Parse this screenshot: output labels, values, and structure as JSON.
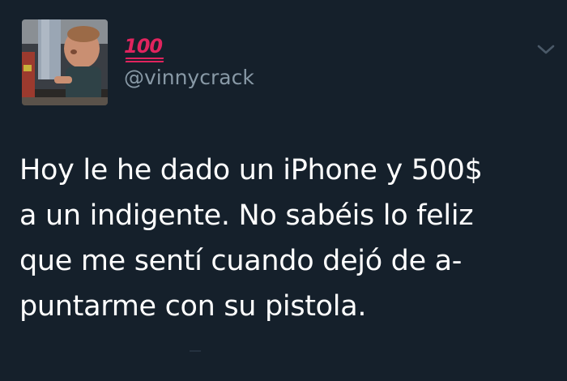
{
  "tweet": {
    "display_name_emoji": "💯",
    "display_name_glyph": "100",
    "handle": "@vinnycrack",
    "text": "Hoy le he dado un iPhone y 500$\na un indigente. No sabéis lo feliz\nque me sentí cuando dejó de a-\npuntarme con su pistola.",
    "menu_icon": "chevron-down-icon",
    "avatar_icon": "avatar"
  },
  "colors": {
    "background": "#15202b",
    "text": "#ffffff",
    "handle": "#8899a6",
    "emoji": "#e0245e",
    "chevron": "#4a5968"
  }
}
